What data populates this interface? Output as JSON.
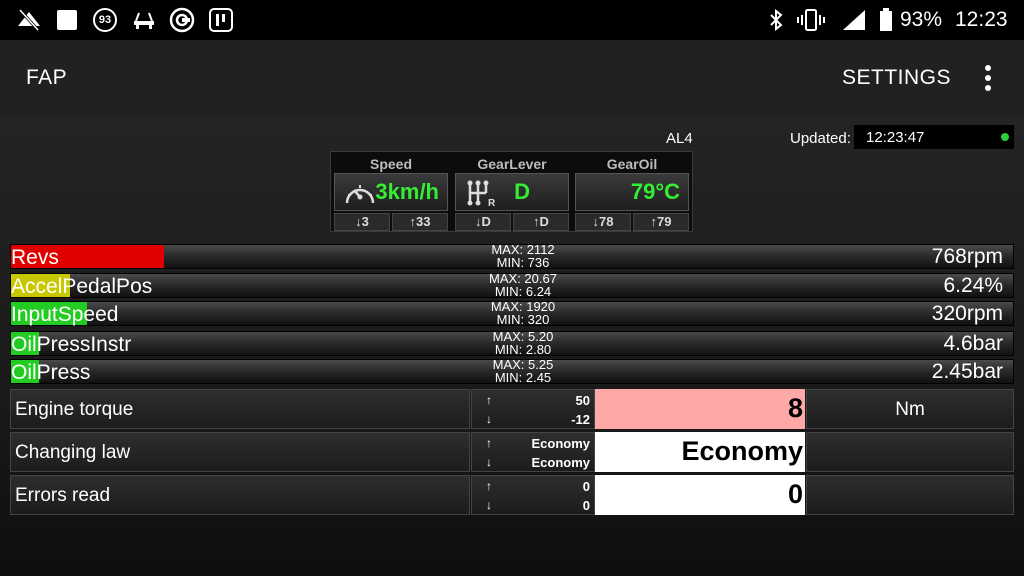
{
  "status_bar": {
    "icons": [
      "wifi-off-icon",
      "notification-square-icon",
      "badge-93-icon",
      "car-icon",
      "cortex-app-icon",
      "mode-icon"
    ],
    "badge_number": "93",
    "right_icons": [
      "bluetooth-icon",
      "vibrate-icon",
      "signal-icon",
      "battery-icon"
    ],
    "battery": "93%",
    "time": "12:23"
  },
  "app_bar": {
    "title": "FAP",
    "settings_label": "SETTINGS",
    "menu_icon": "overflow-menu-icon"
  },
  "header": {
    "gear_code": "AL4",
    "updated_label": "Updated:",
    "updated_time": "12:23:47",
    "status_color": "#2ecc40"
  },
  "gauges": [
    {
      "title": "Speed",
      "icon": "speedometer-icon",
      "value": "3km/h",
      "min": "↓3",
      "max": "↑33"
    },
    {
      "title": "GearLever",
      "icon": "gear-shift-icon",
      "value": "D",
      "min": "↓D",
      "max": "↑D"
    },
    {
      "title": "GearOil",
      "icon": "",
      "value": "79°C",
      "min": "↓78",
      "max": "↑79"
    }
  ],
  "bars": [
    {
      "label": "Revs",
      "max": "MAX: 2112",
      "min": "MIN: 736",
      "value": "768rpm",
      "fill_fraction": 0.153,
      "color": "#e00000"
    },
    {
      "label": "AccelPedalPos",
      "max": "MAX: 20.67",
      "min": "MIN: 6.24",
      "value": "6.24%",
      "fill_fraction": 0.059,
      "color": "#c8c800"
    },
    {
      "label": "InputSpeed",
      "max": "MAX: 1920",
      "min": "MIN: 320",
      "value": "320rpm",
      "fill_fraction": 0.076,
      "color": "#22cc22"
    },
    {
      "label": "OilPressInstr",
      "max": "MAX: 5.20",
      "min": "MIN: 2.80",
      "value": "4.6bar",
      "fill_fraction": 0.028,
      "color": "#22cc22"
    },
    {
      "label": "OilPress",
      "max": "MAX: 5.25",
      "min": "MIN: 2.45",
      "value": "2.45bar",
      "fill_fraction": 0.028,
      "color": "#22cc22"
    }
  ],
  "rows": [
    {
      "name": "Engine torque",
      "up": "↑",
      "down": "↓",
      "max": "50",
      "min": "-12",
      "value": "8",
      "unit": "Nm",
      "bg": "#ffa8a8"
    },
    {
      "name": "Changing law",
      "up": "↑",
      "down": "↓",
      "max": "Economy",
      "min": "Economy",
      "value": "Economy",
      "unit": "",
      "bg": "#ffffff"
    },
    {
      "name": "Errors read",
      "up": "↑",
      "down": "↓",
      "max": "0",
      "min": "0",
      "value": "0",
      "unit": "",
      "bg": "#ffffff"
    }
  ]
}
